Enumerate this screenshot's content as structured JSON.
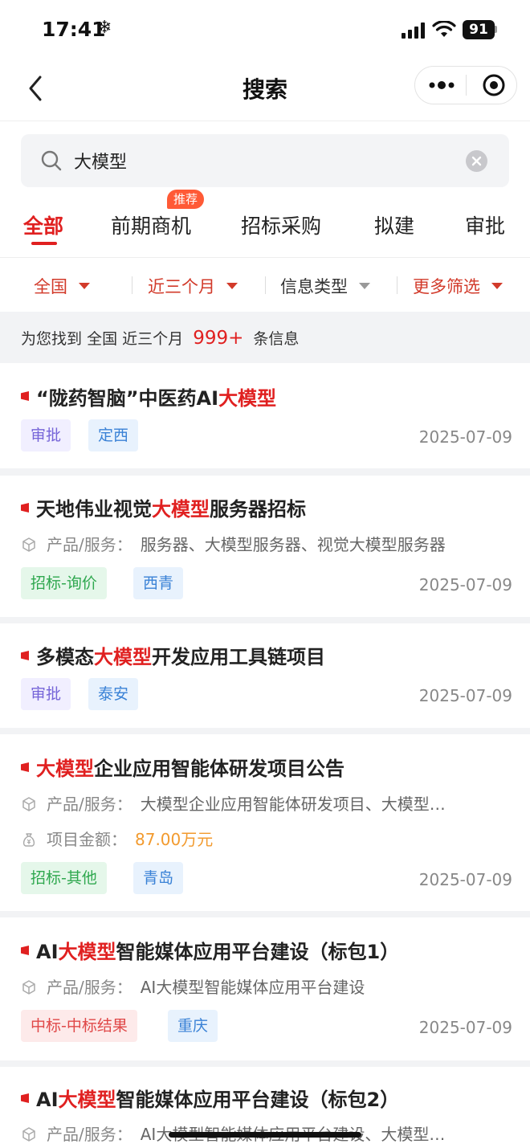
{
  "status_bar": {
    "time": "17:41",
    "battery": "91"
  },
  "nav": {
    "title": "搜索"
  },
  "search": {
    "value": "大模型"
  },
  "tabs": [
    {
      "label": "全部",
      "active": true
    },
    {
      "label": "前期商机",
      "badge": "推荐"
    },
    {
      "label": "招标采购"
    },
    {
      "label": "拟建"
    },
    {
      "label": "审批"
    }
  ],
  "filters": [
    {
      "label": "全国"
    },
    {
      "label": "近三个月"
    },
    {
      "label": "信息类型"
    },
    {
      "label": "更多筛选"
    }
  ],
  "summary": {
    "prefix": "为您找到",
    "region": "全国",
    "period": "近三个月",
    "count": "999+",
    "suffix": "条信息"
  },
  "colors": {
    "accent": "#e02020",
    "money": "#f29a2e"
  },
  "results": [
    {
      "title_pre": "“陇药智脑”中医药AI",
      "title_hl": "大模型",
      "title_post": "",
      "tags": [
        "审批",
        "定西"
      ],
      "date": "2025-07-09"
    },
    {
      "title_pre": "天地伟业视觉",
      "title_hl": "大模型",
      "title_post": "服务器招标",
      "product_label": "产品/服务：",
      "product_value": "服务器、大模型服务器、视觉大模型服务器",
      "tags": [
        "招标-询价",
        "西青"
      ],
      "date": "2025-07-09"
    },
    {
      "title_pre": "多模态",
      "title_hl": "大模型",
      "title_post": "开发应用工具链项目",
      "tags": [
        "审批",
        "泰安"
      ],
      "date": "2025-07-09"
    },
    {
      "title_pre": "",
      "title_hl": "大模型",
      "title_post": "企业应用智能体研发项目公告",
      "product_label": "产品/服务：",
      "product_value": "大模型企业应用智能体研发项目、大模型…",
      "amount_label": "项目金额：",
      "amount_value": "87.00万元",
      "tags": [
        "招标-其他",
        "青岛"
      ],
      "date": "2025-07-09"
    },
    {
      "title_pre": "AI",
      "title_hl": "大模型",
      "title_post": "智能媒体应用平台建设（标包1）",
      "product_label": "产品/服务：",
      "product_value": "AI大模型智能媒体应用平台建设",
      "tags": [
        "中标-中标结果",
        "重庆"
      ],
      "date": "2025-07-09"
    },
    {
      "title_pre": "AI",
      "title_hl": "大模型",
      "title_post": "智能媒体应用平台建设（标包2）",
      "product_label": "产品/服务：",
      "product_value": "AI大模型智能媒体应用平台建设、大模型…"
    }
  ]
}
